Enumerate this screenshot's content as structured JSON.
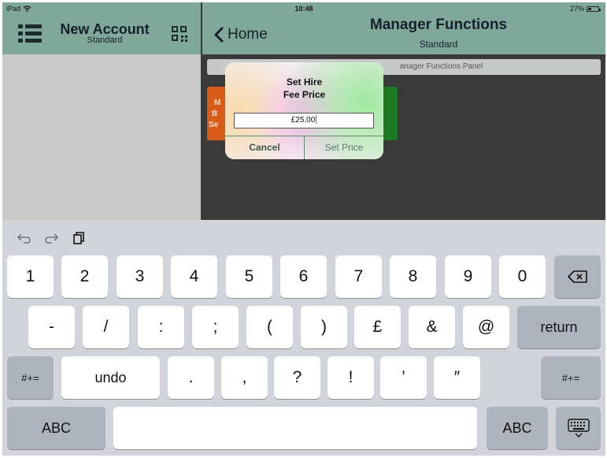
{
  "status_bar": {
    "device": "iPad",
    "time": "10:48",
    "battery": "27%"
  },
  "left_pane": {
    "title": "New Account",
    "subtitle": "Standard"
  },
  "right_pane": {
    "back_label": "Home",
    "title": "Manager Functions",
    "subtitle": "Standard",
    "panel_label": "anager Functions Panel",
    "orange_tile_text": [
      "M",
      "B",
      "Se"
    ]
  },
  "alert": {
    "title_line1": "Set Hire",
    "title_line2": "Fee Price",
    "input_value": "£25.00",
    "cancel_label": "Cancel",
    "confirm_label": "Set Price"
  },
  "keyboard": {
    "row1": [
      "1",
      "2",
      "3",
      "4",
      "5",
      "6",
      "7",
      "8",
      "9",
      "0"
    ],
    "row2": [
      "-",
      "/",
      ":",
      ";",
      "(",
      ")",
      "£",
      "&",
      "@"
    ],
    "return_label": "return",
    "row3_left": "#+=",
    "undo_label": "undo",
    "row3": [
      ".",
      ",",
      "?",
      "!",
      "’",
      "″"
    ],
    "row3_right": "#+=",
    "abc_left": "ABC",
    "abc_right": "ABC",
    "tools": [
      "undo-arrow-icon",
      "redo-arrow-icon",
      "paste-icon"
    ]
  },
  "colors": {
    "header": "#7fa89b",
    "orange_tile": "#d85b18",
    "green_tile": "#1e7a22",
    "dark_bg": "#3a3a3a"
  }
}
